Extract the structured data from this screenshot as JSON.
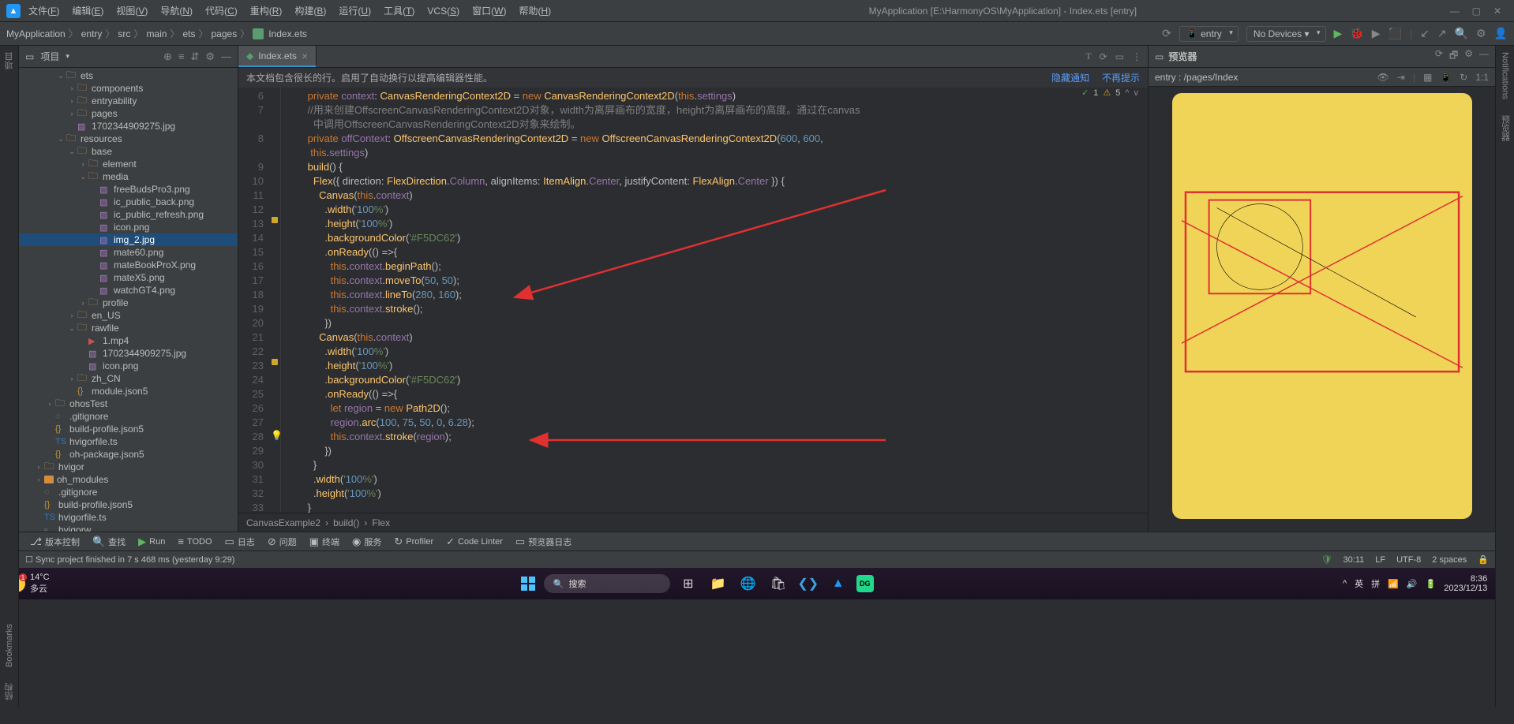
{
  "menubar": {
    "items": [
      "文件(F)",
      "编辑(E)",
      "视图(V)",
      "导航(N)",
      "代码(C)",
      "重构(R)",
      "构建(B)",
      "运行(U)",
      "工具(T)",
      "VCS(S)",
      "窗口(W)",
      "帮助(H)"
    ]
  },
  "window_title": "MyApplication [E:\\HarmonyOS\\MyApplication] - Index.ets [entry]",
  "breadcrumbs": [
    "MyApplication",
    "entry",
    "src",
    "main",
    "ets",
    "pages",
    "Index.ets"
  ],
  "run_config": "entry",
  "devices": "No Devices ▾",
  "project_panel": {
    "title": "项目",
    "tree": [
      {
        "indent": 3,
        "type": "folder",
        "chev": "v",
        "name": "ets"
      },
      {
        "indent": 4,
        "type": "folder",
        "chev": ">",
        "name": "components"
      },
      {
        "indent": 4,
        "type": "folder",
        "chev": ">",
        "name": "entryability"
      },
      {
        "indent": 4,
        "type": "folder",
        "chev": ">",
        "name": "pages"
      },
      {
        "indent": 4,
        "type": "img",
        "name": "1702344909275.jpg"
      },
      {
        "indent": 3,
        "type": "folder",
        "chev": "v",
        "name": "resources"
      },
      {
        "indent": 4,
        "type": "folder",
        "chev": "v",
        "name": "base"
      },
      {
        "indent": 5,
        "type": "folder",
        "chev": ">",
        "name": "element"
      },
      {
        "indent": 5,
        "type": "folder",
        "chev": "v",
        "name": "media"
      },
      {
        "indent": 6,
        "type": "img",
        "name": "freeBudsPro3.png"
      },
      {
        "indent": 6,
        "type": "img",
        "name": "ic_public_back.png"
      },
      {
        "indent": 6,
        "type": "img",
        "name": "ic_public_refresh.png"
      },
      {
        "indent": 6,
        "type": "img",
        "name": "icon.png"
      },
      {
        "indent": 6,
        "type": "img",
        "name": "img_2.jpg",
        "selected": true
      },
      {
        "indent": 6,
        "type": "img",
        "name": "mate60.png"
      },
      {
        "indent": 6,
        "type": "img",
        "name": "mateBookProX.png"
      },
      {
        "indent": 6,
        "type": "img",
        "name": "mateX5.png"
      },
      {
        "indent": 6,
        "type": "img",
        "name": "watchGT4.png"
      },
      {
        "indent": 5,
        "type": "folder",
        "chev": ">",
        "name": "profile"
      },
      {
        "indent": 4,
        "type": "folder",
        "chev": ">",
        "name": "en_US"
      },
      {
        "indent": 4,
        "type": "folder",
        "chev": "v",
        "name": "rawfile"
      },
      {
        "indent": 5,
        "type": "vid",
        "name": "1.mp4"
      },
      {
        "indent": 5,
        "type": "img",
        "name": "1702344909275.jpg"
      },
      {
        "indent": 5,
        "type": "img",
        "name": "icon.png"
      },
      {
        "indent": 4,
        "type": "folder",
        "chev": ">",
        "name": "zh_CN"
      },
      {
        "indent": 4,
        "type": "json",
        "name": "module.json5"
      },
      {
        "indent": 2,
        "type": "folder",
        "chev": ">",
        "name": "ohosTest"
      },
      {
        "indent": 2,
        "type": "git",
        "name": ".gitignore"
      },
      {
        "indent": 2,
        "type": "json",
        "name": "build-profile.json5"
      },
      {
        "indent": 2,
        "type": "ts",
        "name": "hvigorfile.ts"
      },
      {
        "indent": 2,
        "type": "json",
        "name": "oh-package.json5"
      },
      {
        "indent": 1,
        "type": "folder",
        "chev": ">",
        "name": "hvigor"
      },
      {
        "indent": 1,
        "type": "folder-o",
        "chev": ">",
        "name": "oh_modules"
      },
      {
        "indent": 1,
        "type": "git",
        "name": ".gitignore"
      },
      {
        "indent": 1,
        "type": "json",
        "name": "build-profile.json5"
      },
      {
        "indent": 1,
        "type": "ts",
        "name": "hvigorfile.ts"
      },
      {
        "indent": 1,
        "type": "file",
        "name": "hvigorw"
      }
    ]
  },
  "editor": {
    "tab": "Index.ets",
    "notice": "本文档包含很长的行。启用了自动换行以提高编辑器性能。",
    "notice_link1": "隐藏通知",
    "notice_link2": "不再提示",
    "status": {
      "check": "1",
      "warn": "5"
    },
    "bottom_crumbs": [
      "CanvasExample2",
      "build()",
      "Flex"
    ],
    "lines": {
      "start": 6,
      "content": [
        "      private context: CanvasRenderingContext2D = new CanvasRenderingContext2D(this.settings)",
        "      //用来创建OffscreenCanvasRenderingContext2D对象，width为离屏画布的宽度，height为离屏画布的高度。通过在canvas",
        "        中调用OffscreenCanvasRenderingContext2D对象来绘制。",
        "      private offContext: OffscreenCanvasRenderingContext2D = new OffscreenCanvasRenderingContext2D(600, 600,",
        "       this.settings)",
        "",
        "      build() {",
        "        Flex({ direction: FlexDirection.Column, alignItems: ItemAlign.Center, justifyContent: FlexAlign.Center }) {",
        "          Canvas(this.context)",
        "            .width('100%')",
        "            .height('100%')",
        "            .backgroundColor('#F5DC62')",
        "            .onReady(() =>{",
        "              this.context.beginPath();",
        "              this.context.moveTo(50, 50);",
        "              this.context.lineTo(280, 160);",
        "              this.context.stroke();",
        "            })",
        "          Canvas(this.context)",
        "            .width('100%')",
        "            .height('100%')",
        "            .backgroundColor('#F5DC62')",
        "            .onReady(() =>{",
        "              let region = new Path2D();",
        "              region.arc(100, 75, 50, 0, 6.28);",
        "              this.context.stroke(region);",
        "            })",
        "        }",
        "        .width('100%')",
        "        .height('100%')",
        "      }"
      ]
    }
  },
  "preview": {
    "title": "预览器",
    "sub": "entry : /pages/Index"
  },
  "tool_windows_left": [
    "项目",
    "Bookmarks",
    "结构"
  ],
  "tool_windows_right": [
    "Notifications",
    "预览器"
  ],
  "bottom_tools": [
    "版本控制",
    "查找",
    "Run",
    "TODO",
    "日志",
    "问题",
    "终端",
    "服务",
    "Profiler",
    "Code Linter",
    "预览器日志"
  ],
  "status_bar": {
    "msg": "Sync project finished in 7 s 468 ms (yesterday 9:29)",
    "pos": "30:11",
    "lf": "LF",
    "enc": "UTF-8",
    "indent": "2 spaces"
  },
  "taskbar": {
    "weather": {
      "temp": "14°C",
      "desc": "多云",
      "badge": "1"
    },
    "search": "搜索",
    "lang": "英",
    "ime": "拼",
    "time": "8:36",
    "date": "2023/12/13"
  }
}
